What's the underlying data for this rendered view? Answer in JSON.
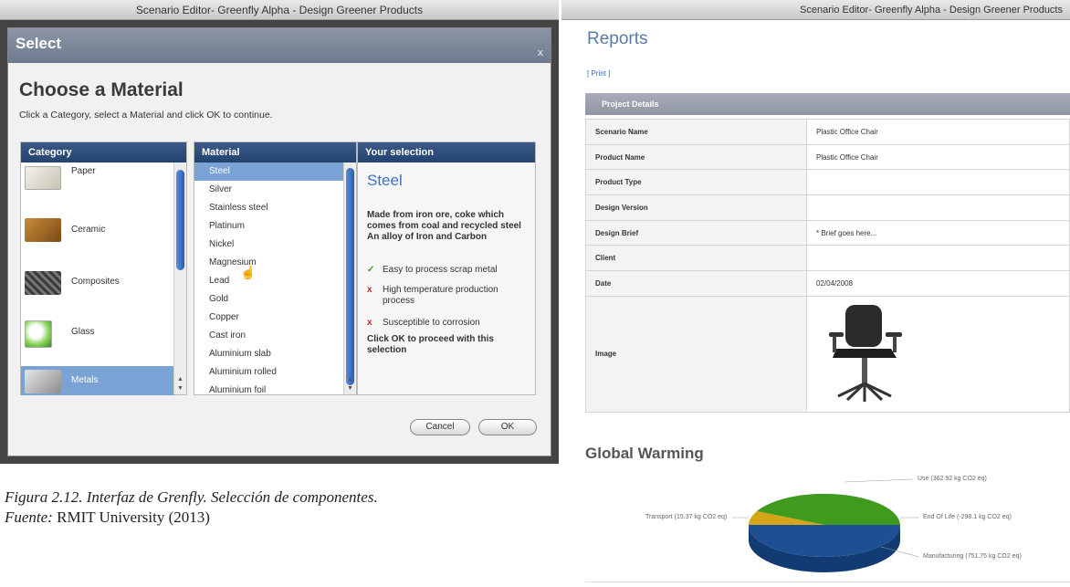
{
  "left_window": {
    "title": "Scenario Editor- Greenfly Alpha - Design Greener Products",
    "dialog": {
      "header": "Select",
      "close": "x",
      "title": "Choose a Material",
      "instruction": "Click a Category, select a Material and click OK to continue.",
      "category": {
        "heading": "Category",
        "items": [
          {
            "label": "Paper",
            "icon": "paper-thumb"
          },
          {
            "label": "Ceramic",
            "icon": "ceramic-thumb"
          },
          {
            "label": "Composites",
            "icon": "composites-thumb"
          },
          {
            "label": "Glass",
            "icon": "glass-thumb"
          },
          {
            "label": "Metals",
            "icon": "metals-thumb",
            "selected": true
          }
        ]
      },
      "material": {
        "heading": "Material",
        "items": [
          "Steel",
          "Silver",
          "Stainless steel",
          "Platinum",
          "Nickel",
          "Magnesium",
          "Lead",
          "Gold",
          "Copper",
          "Cast iron",
          "Aluminium slab",
          "Aluminium rolled",
          "Aluminium foil"
        ],
        "selected": "Steel"
      },
      "selection": {
        "heading": "Your selection",
        "name": "Steel",
        "description": "Made from iron ore, coke which comes from coal and recycled steel An alloy of Iron and Carbon",
        "properties": [
          {
            "type": "pro",
            "icon": "✓",
            "text": "Easy to process scrap metal"
          },
          {
            "type": "con",
            "icon": "x",
            "text": "High temperature production process"
          },
          {
            "type": "con",
            "icon": "x",
            "text": "Susceptible to corrosion"
          }
        ],
        "proceed": "Click OK to proceed with this selection"
      },
      "buttons": {
        "cancel": "Cancel",
        "ok": "OK"
      }
    }
  },
  "caption": {
    "figure": "Figura 2.12. Interfaz de Grenfly. Selección de componentes.",
    "source_label": "Fuente:",
    "source": "RMIT University (2013)"
  },
  "right_window": {
    "title": "Scenario Editor- Greenfly Alpha - Design Greener Products",
    "reports_title": "Reports",
    "print_link": "[ Print ]",
    "project_details_heading": "Project Details",
    "project_rows": [
      {
        "key": "Scenario Name",
        "value": "Plastic Office Chair"
      },
      {
        "key": "Product Name",
        "value": "Plastic Office Chair"
      },
      {
        "key": "Product Type",
        "value": ""
      },
      {
        "key": "Design Version",
        "value": ""
      },
      {
        "key": "Design Brief",
        "value": "* Brief goes here..."
      },
      {
        "key": "Client",
        "value": ""
      },
      {
        "key": "Date",
        "value": "02/04/2008"
      },
      {
        "key": "Image",
        "value": "",
        "image": "office-chair"
      }
    ],
    "global_warming": {
      "title": "Global Warming",
      "slices": [
        {
          "label": "Use (362.92 kg CO2 eq)",
          "value": 362.92,
          "color": "#3f9a1e"
        },
        {
          "label": "End Of Life (-298.1 kg CO2 eq)",
          "value": -298.1,
          "color": "#3f9a1e"
        },
        {
          "label": "Manufacturing (751.75 kg CO2 eq)",
          "value": 751.75,
          "color": "#1e4f93"
        },
        {
          "label": "Transport (15.37 kg CO2 eq)",
          "value": 15.37,
          "color": "#d4a419"
        }
      ]
    }
  }
}
